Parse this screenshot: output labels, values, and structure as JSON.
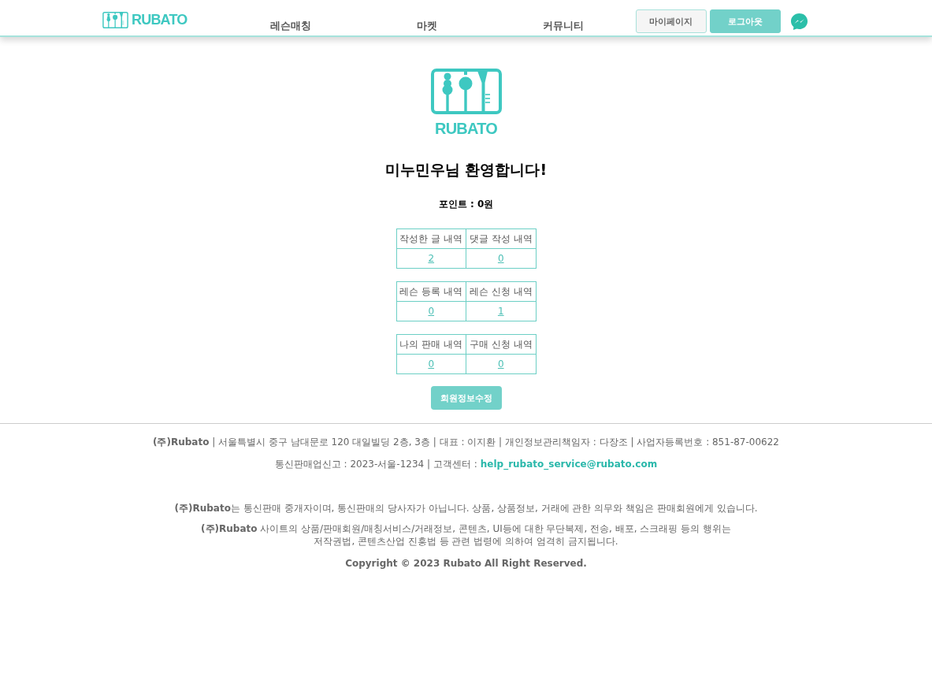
{
  "header": {
    "logo": {
      "text": "RUBATO"
    },
    "nav": [
      {
        "label": "레슨매칭"
      },
      {
        "label": "마켓"
      },
      {
        "label": "커뮤니티"
      }
    ],
    "buttons": [
      {
        "kind": "outline",
        "label": "마이페이지"
      },
      {
        "kind": "filled",
        "label": "로그아웃"
      }
    ]
  },
  "profile": {
    "logo_text": "RUBATO",
    "welcome": "미누민우님 환영합니다!",
    "points": "포인트 : 0원",
    "tables": [
      {
        "columns": [
          "작성한 글 내역",
          "댓글 작성 내역"
        ],
        "counts": [
          "2",
          "0"
        ]
      },
      {
        "columns": [
          "레슨 등록 내역",
          "레슨 신청 내역"
        ],
        "counts": [
          "0",
          "1"
        ]
      },
      {
        "columns": [
          "나의 판매 내역",
          "구매 신청 내역"
        ],
        "counts": [
          "0",
          "0"
        ]
      }
    ],
    "edit_button": "회원정보수정"
  },
  "footer": {
    "company_line": "**(주)Rubato** | 서울특별시 중구 남대문로 120 대일빌딩 2층, 3층 | 대표 : 이지환 | 개인정보관리책임자 : 다장조 | 사업자등록번호 : 851-87-00622",
    "contact": {
      "text": "통신판매업신고 : 2023-서울-1234 | 고객센터 :",
      "email": "help_rubato_service@rubato.com"
    },
    "notices": [
      {
        "lines": [
          "**(주)Rubato**는 통신판매 중개자이며, 통신판매의 당사자가 아닙니다. 상품, 상품정보, 거래에 관한 의무와 책임은 판매회원에게 있습니다."
        ]
      },
      {
        "lines": [
          "**(주)Rubato** 사이트의 상품/판매회원/매칭서비스/거래정보, 콘텐츠, UI등에 대한 무단복제, 전송, 배포, 스크래핑 등의 행위는",
          "저작권법, 콘텐츠산업 진흥법 등 관련 법령에 의하여 엄격히 금지됩니다."
        ]
      }
    ],
    "copyright": "Copyright © 2023 Rubato All Right Reserved."
  }
}
